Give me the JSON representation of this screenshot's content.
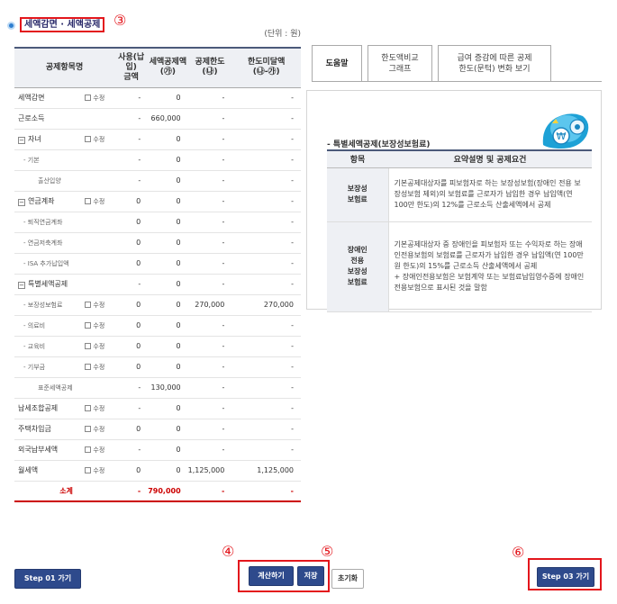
{
  "header": {
    "title": "세액감면 · 세액공제",
    "unit": "(단위 : 원)",
    "marker": "③"
  },
  "table": {
    "columns": [
      "공제항목명",
      "사용(납입)\n금액",
      "세액공제액\n(㉮)",
      "공제한도\n(㉯)",
      "한도미달액\n(㉯-㉮)"
    ],
    "rows": [
      {
        "name": "세액감면",
        "mod": "수정",
        "used": "-",
        "credit": "0",
        "limit": "-",
        "short": "-"
      },
      {
        "name": "근로소득",
        "mod": "",
        "used": "-",
        "credit": "660,000",
        "limit": "-",
        "short": "-"
      },
      {
        "name": "자녀",
        "mod": "수정",
        "used": "-",
        "credit": "0",
        "limit": "-",
        "short": "-"
      },
      {
        "name": "- 기본",
        "mod": "",
        "used": "-",
        "credit": "0",
        "limit": "-",
        "short": "-"
      },
      {
        "name": "출산입양",
        "mod": "",
        "used": "-",
        "credit": "0",
        "limit": "-",
        "short": "-"
      },
      {
        "name": "연금계좌",
        "mod": "수정",
        "used": "0",
        "credit": "0",
        "limit": "-",
        "short": "-"
      },
      {
        "name": "- 퇴직연금계좌",
        "mod": "",
        "used": "0",
        "credit": "0",
        "limit": "-",
        "short": "-"
      },
      {
        "name": "- 연금저축계좌",
        "mod": "",
        "used": "0",
        "credit": "0",
        "limit": "-",
        "short": "-"
      },
      {
        "name": "- ISA 추가납입액",
        "mod": "",
        "used": "0",
        "credit": "0",
        "limit": "-",
        "short": "-"
      },
      {
        "name": "특별세액공제",
        "mod": "",
        "used": "-",
        "credit": "0",
        "limit": "-",
        "short": "-"
      },
      {
        "name": "- 보장성보험료",
        "mod": "수정",
        "used": "0",
        "credit": "0",
        "limit": "270,000",
        "short": "270,000"
      },
      {
        "name": "- 의료비",
        "mod": "수정",
        "used": "0",
        "credit": "0",
        "limit": "-",
        "short": "-"
      },
      {
        "name": "- 교육비",
        "mod": "수정",
        "used": "0",
        "credit": "0",
        "limit": "-",
        "short": "-"
      },
      {
        "name": "- 기부금",
        "mod": "수정",
        "used": "0",
        "credit": "0",
        "limit": "-",
        "short": "-"
      },
      {
        "name": "표준세액공제",
        "mod": "",
        "used": "-",
        "credit": "130,000",
        "limit": "-",
        "short": "-"
      },
      {
        "name": "납세조합공제",
        "mod": "수정",
        "used": "-",
        "credit": "0",
        "limit": "-",
        "short": "-"
      },
      {
        "name": "주택차입금",
        "mod": "수정",
        "used": "0",
        "credit": "0",
        "limit": "-",
        "short": "-"
      },
      {
        "name": "외국납부세액",
        "mod": "수정",
        "used": "-",
        "credit": "0",
        "limit": "-",
        "short": "-"
      },
      {
        "name": "월세액",
        "mod": "수정",
        "used": "0",
        "credit": "0",
        "limit": "1,125,000",
        "short": "1,125,000"
      }
    ],
    "total": {
      "name": "소계",
      "used": "-",
      "credit": "790,000",
      "limit": "-",
      "short": "-"
    }
  },
  "tabs": [
    "도움말",
    "한도액비교\n그래프",
    "급여 증감에 따른 공제\n한도(문턱) 변화 보기"
  ],
  "help": {
    "caption": "- 특별세액공제(보장성보험료)",
    "head_key": "항목",
    "head_val": "요약설명 및 공제요건",
    "items": [
      {
        "key": "보장성\n보험료",
        "desc": "기본공제대상자를 피보험자로 하는 보장성보험(장애인 전용 보장성보험 제외)의 보험료를 근로자가 납입한 경우 납입액(연 100만 한도)의 12%를 근로소득 산출세액에서 공제"
      },
      {
        "key": "장애인\n전용\n보장성\n보험료",
        "desc": "기본공제대상자 중 장애인을 피보험자 또는 수익자로 하는 장애인전용보험의 보험료를 근로자가 납입한 경우 납입액(연 100만원 한도)의 15%를 근로소득 산출세액에서 공제\n+ 장애인전용보험은 보험계약 또는 보험료납입영수증에 장애인전용보험으로 표시된 것을 말함"
      }
    ]
  },
  "buttons": {
    "step1": "Step 01 가기",
    "calc": "계산하기",
    "save": "저장",
    "reset": "초기화",
    "step3": "Step 03 가기"
  },
  "markers": {
    "m4": "④",
    "m5": "⑤",
    "m6": "⑥"
  },
  "colors": {
    "accent_red": "#e3161c",
    "button_blue": "#2e4a8c"
  }
}
